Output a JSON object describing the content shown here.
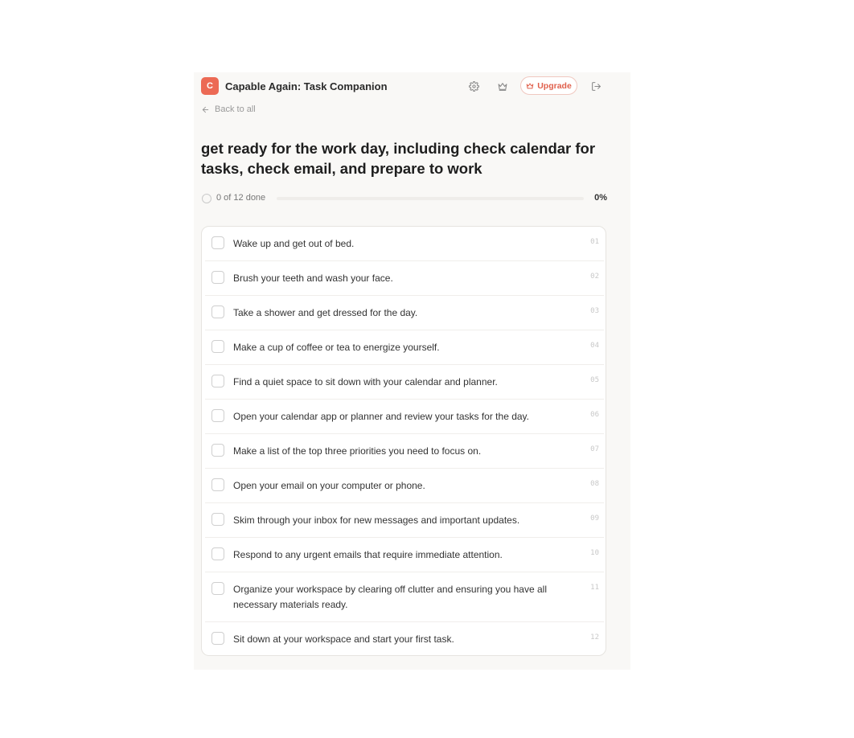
{
  "header": {
    "logo_letter": "C",
    "app_title": "Capable Again: Task Companion",
    "upgrade_label": "Upgrade",
    "icons": [
      "gear-icon",
      "crown-icon",
      "logout-icon"
    ]
  },
  "nav": {
    "back_label": "Back to all"
  },
  "task": {
    "title": "get ready for the work day, including check calendar for tasks, check email, and prepare to work"
  },
  "progress": {
    "text": "0 of 12 done",
    "percent_label": "0%",
    "fraction": 0
  },
  "steps": [
    {
      "num": "01",
      "text": "Wake up and get out of bed."
    },
    {
      "num": "02",
      "text": "Brush your teeth and wash your face."
    },
    {
      "num": "03",
      "text": "Take a shower and get dressed for the day."
    },
    {
      "num": "04",
      "text": "Make a cup of coffee or tea to energize yourself."
    },
    {
      "num": "05",
      "text": "Find a quiet space to sit down with your calendar and planner."
    },
    {
      "num": "06",
      "text": "Open your calendar app or planner and review your tasks for the day."
    },
    {
      "num": "07",
      "text": "Make a list of the top three priorities you need to focus on."
    },
    {
      "num": "08",
      "text": "Open your email on your computer or phone."
    },
    {
      "num": "09",
      "text": "Skim through your inbox for new messages and important updates."
    },
    {
      "num": "10",
      "text": "Respond to any urgent emails that require immediate attention."
    },
    {
      "num": "11",
      "text": "Organize your workspace by clearing off clutter and ensuring you have all necessary materials ready."
    },
    {
      "num": "12",
      "text": "Sit down at your workspace and start your first task."
    }
  ],
  "colors": {
    "accent": "#ec6a55",
    "panel_bg": "#f9f8f6"
  }
}
